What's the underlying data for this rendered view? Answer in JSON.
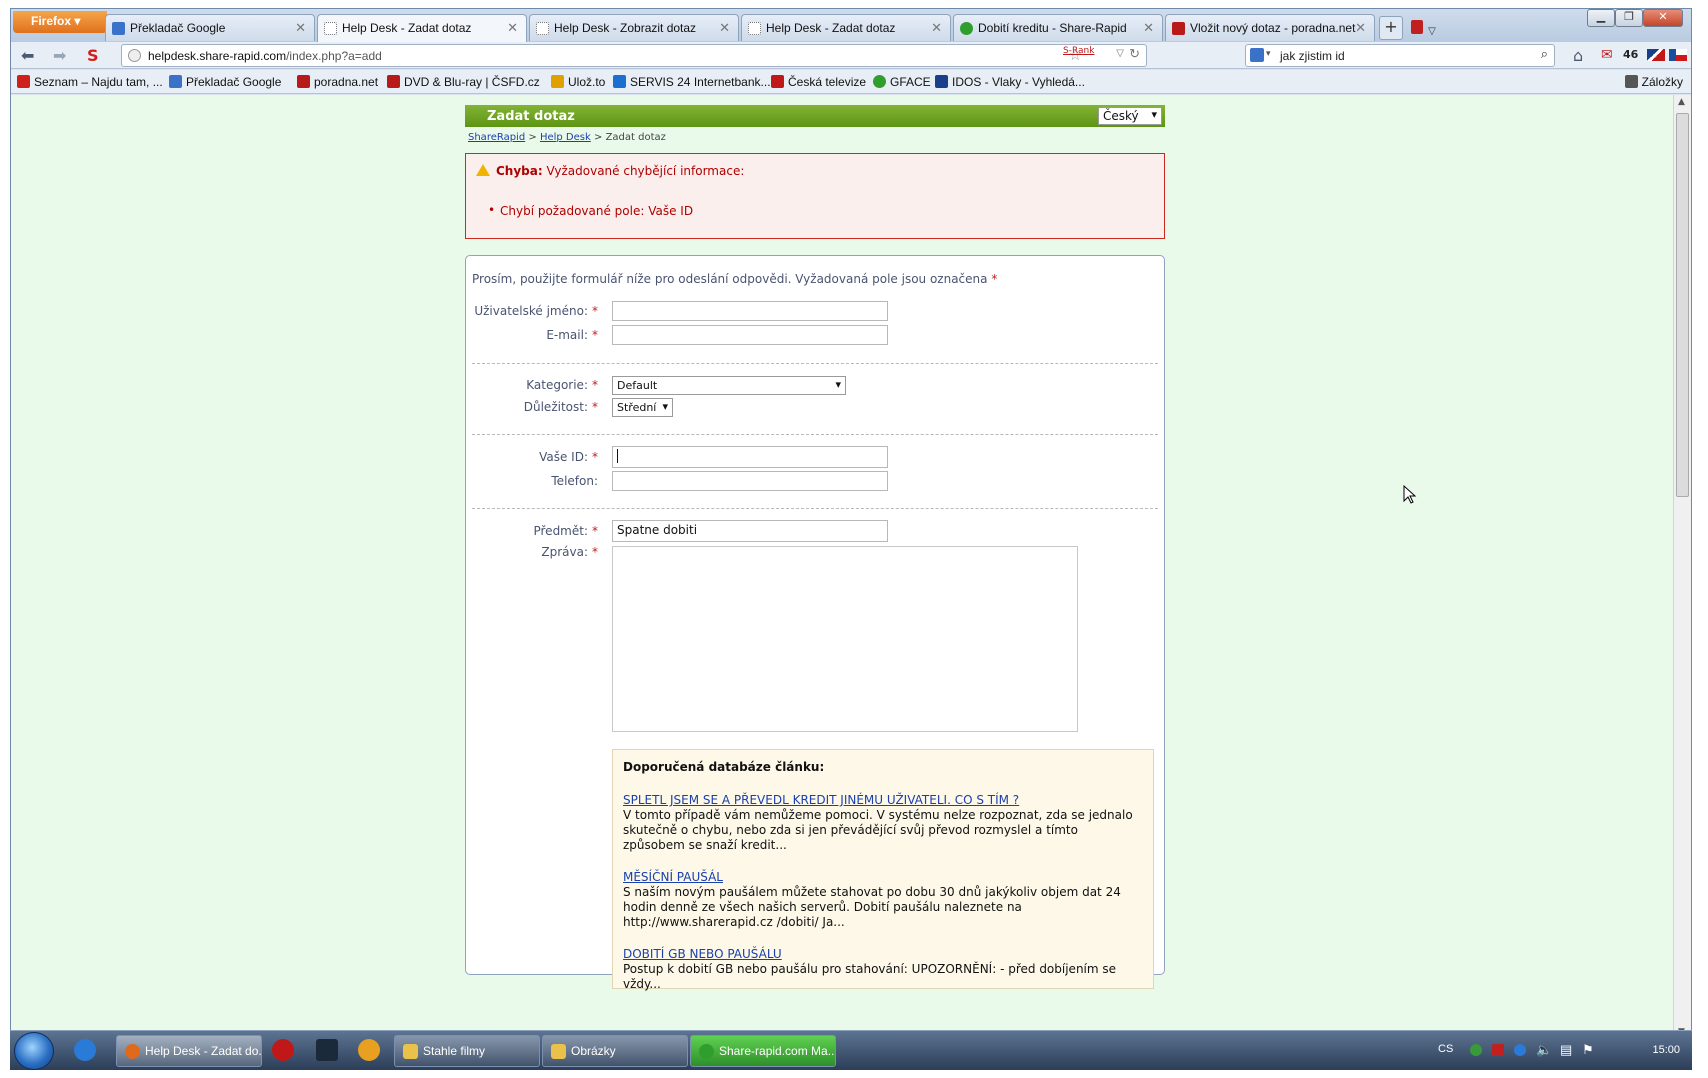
{
  "browser": {
    "app_button": "Firefox",
    "tabs": [
      {
        "label": "Překladač Google",
        "active": false
      },
      {
        "label": "Help Desk - Zadat dotaz",
        "active": true
      },
      {
        "label": "Help Desk - Zobrazit dotaz",
        "active": false
      },
      {
        "label": "Help Desk - Zadat dotaz",
        "active": false
      },
      {
        "label": "Dobití kreditu - Share-Rapid",
        "active": false
      },
      {
        "label": "Vložit nový dotaz - poradna.net",
        "active": false
      }
    ],
    "new_tab": "+",
    "url_host": "helpdesk.share-rapid.com",
    "url_prefix": "",
    "url_suffix": "/index.php?a=add",
    "srank": "S-Rank",
    "search_value": "jak zjistim id",
    "counter": "46",
    "bookmarks": [
      {
        "label": "Seznam – Najdu tam, ...",
        "color": "#d0201b"
      },
      {
        "label": "Překladač Google",
        "color": "#3a72c9"
      },
      {
        "label": "poradna.net",
        "color": "#b81a1a"
      },
      {
        "label": "DVD & Blu-ray | ČSFD.cz",
        "color": "#b81a1a"
      },
      {
        "label": "Ulož.to",
        "color": "#e0a000"
      },
      {
        "label": "SERVIS 24 Internetbank...",
        "color": "#1a6fd0"
      },
      {
        "label": "Česká televize",
        "color": "#c01818"
      },
      {
        "label": "GFACE",
        "color": "#2f9e2f"
      },
      {
        "label": "IDOS - Vlaky - Vyhledá...",
        "color": "#1a3f8a"
      }
    ],
    "bookmarks_menu": "Záložky"
  },
  "page": {
    "title": "Zadat dotaz",
    "language": "Český",
    "breadcrumb": {
      "link1": "ShareRapid",
      "sep1": ">",
      "link2": "Help Desk",
      "sep2": ">",
      "current": "Zadat dotaz"
    },
    "error": {
      "title_bold": "Chyba:",
      "title_text": "Vyžadované chybějící informace:",
      "item": "Chybí požadované pole: Vaše ID"
    },
    "form": {
      "intro": "Prosím, použijte formulář níže pro odeslání odpovědi. Vyžadovaná pole jsou označena",
      "required_mark": "*",
      "username_label": "Uživatelské jméno:",
      "username_value": "",
      "email_label": "E-mail:",
      "email_value": "",
      "category_label": "Kategorie:",
      "category_value": "Default",
      "priority_label": "Důležitost:",
      "priority_value": "Střední",
      "id_label": "Vaše ID:",
      "id_value": "",
      "phone_label": "Telefon:",
      "phone_value": "",
      "subject_label": "Předmět:",
      "subject_value": "Spatne dobiti",
      "message_label": "Zpráva:",
      "message_value": ""
    },
    "kb": {
      "title": "Doporučená databáze článku:",
      "articles": [
        {
          "title": "SPLETL JSEM SE A PŘEVEDL KREDIT JINÉMU UŽIVATELI. CO S TÍM ?",
          "text": "V tomto případě vám nemůžeme pomoci. V systému nelze rozpoznat, zda se jednalo skutečně o chybu, nebo zda si jen převádějící svůj převod rozmyslel a tímto způsobem se snaží kredit..."
        },
        {
          "title": "MĚSÍČNÍ PAUŠÁL",
          "text": "S naším novým paušálem můžete stahovat po dobu 30 dnů jakýkoliv objem dat 24 hodin denně ze všech našich serverů. Dobití paušálu naleznete na http://www.sharerapid.cz /dobiti/ Ja..."
        },
        {
          "title": "DOBITÍ GB NEBO PAUŠÁLU",
          "text": "Postup k dobití GB nebo paušálu pro stahování: UPOZORNĚNÍ: - před dobíjením se vždy..."
        }
      ]
    }
  },
  "taskbar": {
    "items": [
      {
        "label": "Help Desk - Zadat do...",
        "color": "#e06a1a"
      },
      {
        "label": "Stahle filmy",
        "color": "#e8c24a"
      },
      {
        "label": "Obrázky",
        "color": "#e8c24a"
      },
      {
        "label": "Share-rapid.com Ma...",
        "color": "#2f9e2f"
      }
    ],
    "lang": "CS",
    "clock": "15:00"
  }
}
